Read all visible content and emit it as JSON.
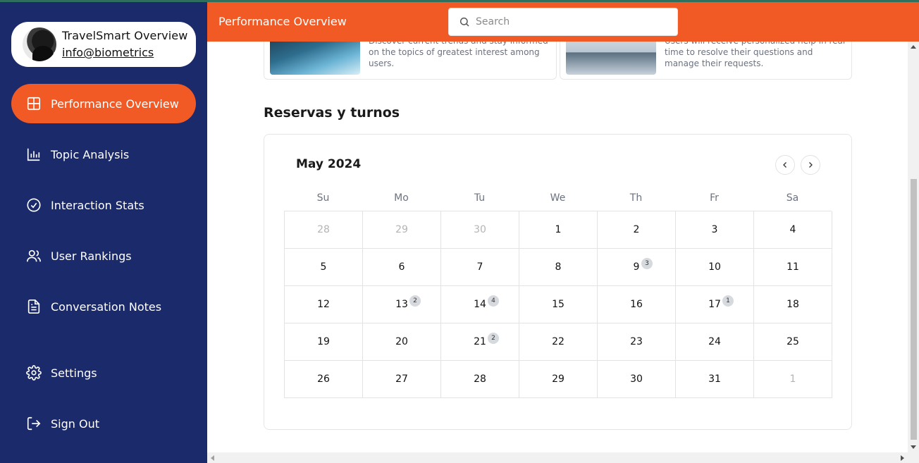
{
  "profile": {
    "name": "TravelSmart Overview",
    "email": "info@biometrics"
  },
  "sidebar": {
    "items": [
      {
        "label": "Performance Overview",
        "icon": "grid-icon"
      },
      {
        "label": "Topic Analysis",
        "icon": "bar-chart-icon"
      },
      {
        "label": "Interaction Stats",
        "icon": "check-circle-icon"
      },
      {
        "label": "User Rankings",
        "icon": "users-icon"
      },
      {
        "label": "Conversation Notes",
        "icon": "document-icon"
      },
      {
        "label": "Settings",
        "icon": "gear-icon"
      },
      {
        "label": "Sign Out",
        "icon": "sign-out-icon"
      }
    ]
  },
  "header": {
    "title": "Performance Overview",
    "search_placeholder": "Search"
  },
  "cards": [
    {
      "text": "Discover current trends and stay informed on the topics of greatest interest among users."
    },
    {
      "text": "Users will receive personalized help in real time to resolve their questions and manage their requests."
    }
  ],
  "section": {
    "title": "Reservas y turnos"
  },
  "calendar": {
    "month": "May 2024",
    "weekdays": [
      "Su",
      "Mo",
      "Tu",
      "We",
      "Th",
      "Fr",
      "Sa"
    ],
    "days": [
      {
        "d": "28",
        "muted": true
      },
      {
        "d": "29",
        "muted": true
      },
      {
        "d": "30",
        "muted": true
      },
      {
        "d": "1"
      },
      {
        "d": "2"
      },
      {
        "d": "3"
      },
      {
        "d": "4"
      },
      {
        "d": "5"
      },
      {
        "d": "6"
      },
      {
        "d": "7"
      },
      {
        "d": "8"
      },
      {
        "d": "9",
        "badge": "3"
      },
      {
        "d": "10"
      },
      {
        "d": "11"
      },
      {
        "d": "12"
      },
      {
        "d": "13",
        "badge": "2"
      },
      {
        "d": "14",
        "badge": "4"
      },
      {
        "d": "15"
      },
      {
        "d": "16"
      },
      {
        "d": "17",
        "badge": "1"
      },
      {
        "d": "18"
      },
      {
        "d": "19"
      },
      {
        "d": "20"
      },
      {
        "d": "21",
        "badge": "2"
      },
      {
        "d": "22"
      },
      {
        "d": "23"
      },
      {
        "d": "24"
      },
      {
        "d": "25"
      },
      {
        "d": "26"
      },
      {
        "d": "27"
      },
      {
        "d": "28"
      },
      {
        "d": "29"
      },
      {
        "d": "30"
      },
      {
        "d": "31"
      },
      {
        "d": "1",
        "muted": true
      }
    ]
  },
  "colors": {
    "sidebar_bg": "#1b2a6b",
    "accent": "#f15a24"
  }
}
